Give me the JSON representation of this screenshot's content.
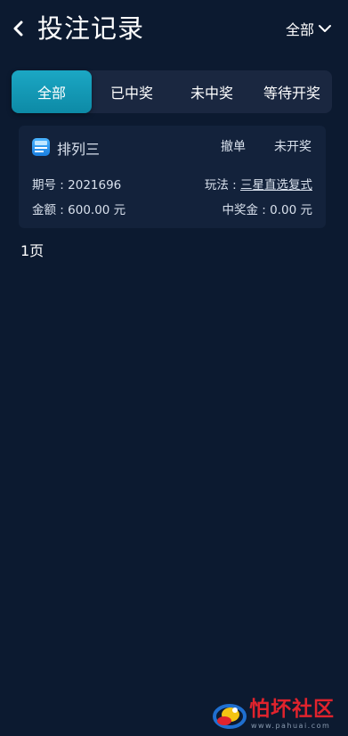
{
  "header": {
    "title": "投注记录",
    "filter_label": "全部"
  },
  "tabs": [
    {
      "label": "全部",
      "active": true
    },
    {
      "label": "已中奖",
      "active": false
    },
    {
      "label": "未中奖",
      "active": false
    },
    {
      "label": "等待开奖",
      "active": false
    }
  ],
  "record": {
    "lottery_name": "排列三",
    "cancel_label": "撤单",
    "status": "未开奖",
    "issue_label": "期号 : ",
    "issue_value": "2021696",
    "play_label": "玩法 : ",
    "play_value": "三星直选复式",
    "amount_label": "金额 : ",
    "amount_value": "600.00 元",
    "prize_label": "中奖金 : ",
    "prize_value": "0.00 元"
  },
  "pager": {
    "text": "1页"
  },
  "watermark": {
    "title": "怕坏社区",
    "url": "www.pahuai.com"
  },
  "colors": {
    "background": "#0c1a30",
    "tab_bar": "#1a2740",
    "tab_active": "#1ba7c4",
    "card": "#13223b",
    "watermark_red": "#e0232d"
  }
}
